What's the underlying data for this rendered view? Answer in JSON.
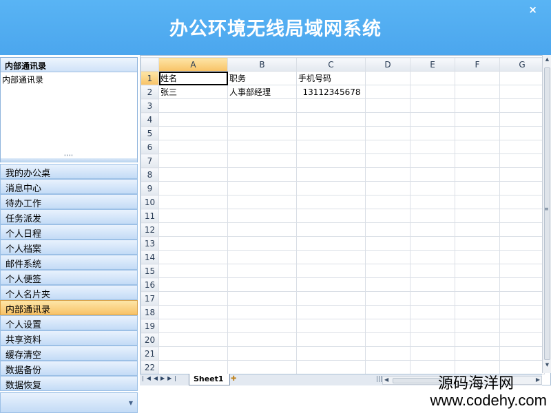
{
  "header": {
    "title": "办公环境无线局域网系统",
    "close_label": "×"
  },
  "left_panel": {
    "panel_title": "内部通讯录",
    "panel_content": "内部通讯录",
    "splitter_grip": "''''",
    "nav_items": [
      {
        "label": "我的办公桌",
        "active": false
      },
      {
        "label": "消息中心",
        "active": false
      },
      {
        "label": "待办工作",
        "active": false
      },
      {
        "label": "任务派发",
        "active": false
      },
      {
        "label": "个人日程",
        "active": false
      },
      {
        "label": "个人档案",
        "active": false
      },
      {
        "label": "邮件系统",
        "active": false
      },
      {
        "label": "个人便签",
        "active": false
      },
      {
        "label": "个人名片夹",
        "active": false
      },
      {
        "label": "内部通讯录",
        "active": true
      },
      {
        "label": "个人设置",
        "active": false
      },
      {
        "label": "共享资料",
        "active": false
      },
      {
        "label": "缓存清空",
        "active": false
      },
      {
        "label": "数据备份",
        "active": false
      },
      {
        "label": "数据恢复",
        "active": false
      }
    ]
  },
  "spreadsheet": {
    "columns": [
      "A",
      "B",
      "C",
      "D",
      "E",
      "F",
      "G"
    ],
    "selected_column": "A",
    "selected_row": "1",
    "row_numbers": [
      "1",
      "2",
      "3",
      "4",
      "5",
      "6",
      "7",
      "8",
      "9",
      "10",
      "11",
      "12",
      "13",
      "14",
      "15",
      "16",
      "17",
      "18",
      "19",
      "20",
      "21",
      "22"
    ],
    "rows": [
      [
        "姓名",
        "职务",
        "手机号码",
        "",
        "",
        "",
        ""
      ],
      [
        "张三",
        "人事部经理",
        "13112345678",
        "",
        "",
        "",
        ""
      ]
    ],
    "sheet_tab": "Sheet1"
  },
  "watermark": {
    "line1": "源码海洋网",
    "line2": "www.codehy.com"
  }
}
